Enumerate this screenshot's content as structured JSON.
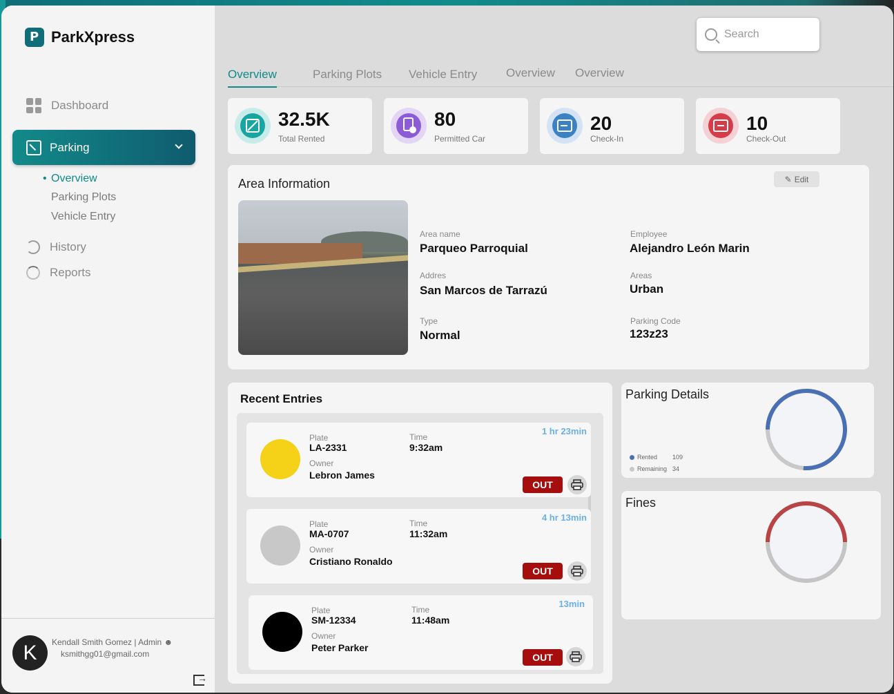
{
  "brand": {
    "name": "ParkXpress"
  },
  "sidebar": {
    "dashboard": "Dashboard",
    "parking": "Parking",
    "sub_items": [
      "Overview",
      "Parking Plots",
      "Vehicle Entry"
    ],
    "history": "History",
    "reports": "Reports"
  },
  "user": {
    "initial": "K",
    "line": "Kendall Smith Gomez | Admin",
    "email": "ksmithgg01@gmail.com"
  },
  "search": {
    "placeholder": "Search"
  },
  "tabs": [
    "Overview",
    "Parking Plots",
    "Vehicle Entry",
    "Overview",
    "Overview"
  ],
  "stats": [
    {
      "value": "32.5K",
      "label": "Total Rented",
      "color": "#1aa6a0"
    },
    {
      "value": "80",
      "label": "Permitted Car",
      "color": "#8e5bd6"
    },
    {
      "value": "20",
      "label": "Check-In",
      "color": "#3b82c4"
    },
    {
      "value": "10",
      "label": "Check-Out",
      "color": "#d63b4a"
    }
  ],
  "area": {
    "title": "Area Information",
    "edit": "Edit",
    "fields": {
      "area_name_label": "Area name",
      "area_name": "Parqueo Parroquial",
      "employee_label": "Employee",
      "employee": "Alejandro León Marin",
      "address_label": "Addres",
      "address": "San Marcos de Tarrazú",
      "areas_label": "Areas",
      "areas": "Urban",
      "type_label": "Type",
      "type": "Normal",
      "code_label": "Parking Code",
      "code": "123z23"
    }
  },
  "recent": {
    "title": "Recent Entries",
    "plate_label": "Plate",
    "owner_label": "Owner",
    "time_label": "Time",
    "out_label": "OUT",
    "entries": [
      {
        "plate": "LA-2331",
        "owner": "Lebron James",
        "time": "9:32am",
        "duration": "1 hr 23min",
        "color": "#f5d117"
      },
      {
        "plate": "MA-0707",
        "owner": "Cristiano Ronaldo",
        "time": "11:32am",
        "duration": "4 hr 13min",
        "color": "#c8c8c8"
      },
      {
        "plate": "SM-12334",
        "owner": "Peter Parker",
        "time": "11:48am",
        "duration": "13min",
        "color": "#000000"
      }
    ]
  },
  "parking_details": {
    "title": "Parking Details",
    "legend": [
      {
        "label": "Rented",
        "value": "109",
        "color": "#4a6fb3"
      },
      {
        "label": "Remaining",
        "value": "34",
        "color": "#c9c9c9"
      }
    ]
  },
  "fines": {
    "title": "Fines"
  },
  "chart_data": [
    {
      "type": "pie",
      "title": "Parking Details",
      "categories": [
        "Rented",
        "Remaining"
      ],
      "values": [
        109,
        34
      ]
    },
    {
      "type": "pie",
      "title": "Fines",
      "categories": [],
      "values": []
    }
  ]
}
